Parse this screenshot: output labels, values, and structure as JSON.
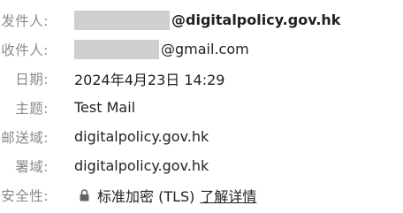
{
  "header": {
    "from": {
      "label": "发件人:",
      "domain": "@digitalpolicy.gov.hk"
    },
    "to": {
      "label": "收件人:",
      "domain": "@gmail.com"
    },
    "date": {
      "label": "日期:",
      "value": "2024年4月23日 14:29"
    },
    "subject": {
      "label": "主题:",
      "value": "Test Mail"
    },
    "mailed_by": {
      "label": "邮送域:",
      "value": "digitalpolicy.gov.hk"
    },
    "signed_by": {
      "label": "署域:",
      "value": "digitalpolicy.gov.hk"
    },
    "security": {
      "label": "安全性:",
      "value": "标准加密 (TLS)",
      "link": "了解详情",
      "icon": "lock-icon"
    }
  },
  "colors": {
    "label": "#8a8a8a",
    "text": "#202124",
    "redaction": "#cfcfcf"
  }
}
